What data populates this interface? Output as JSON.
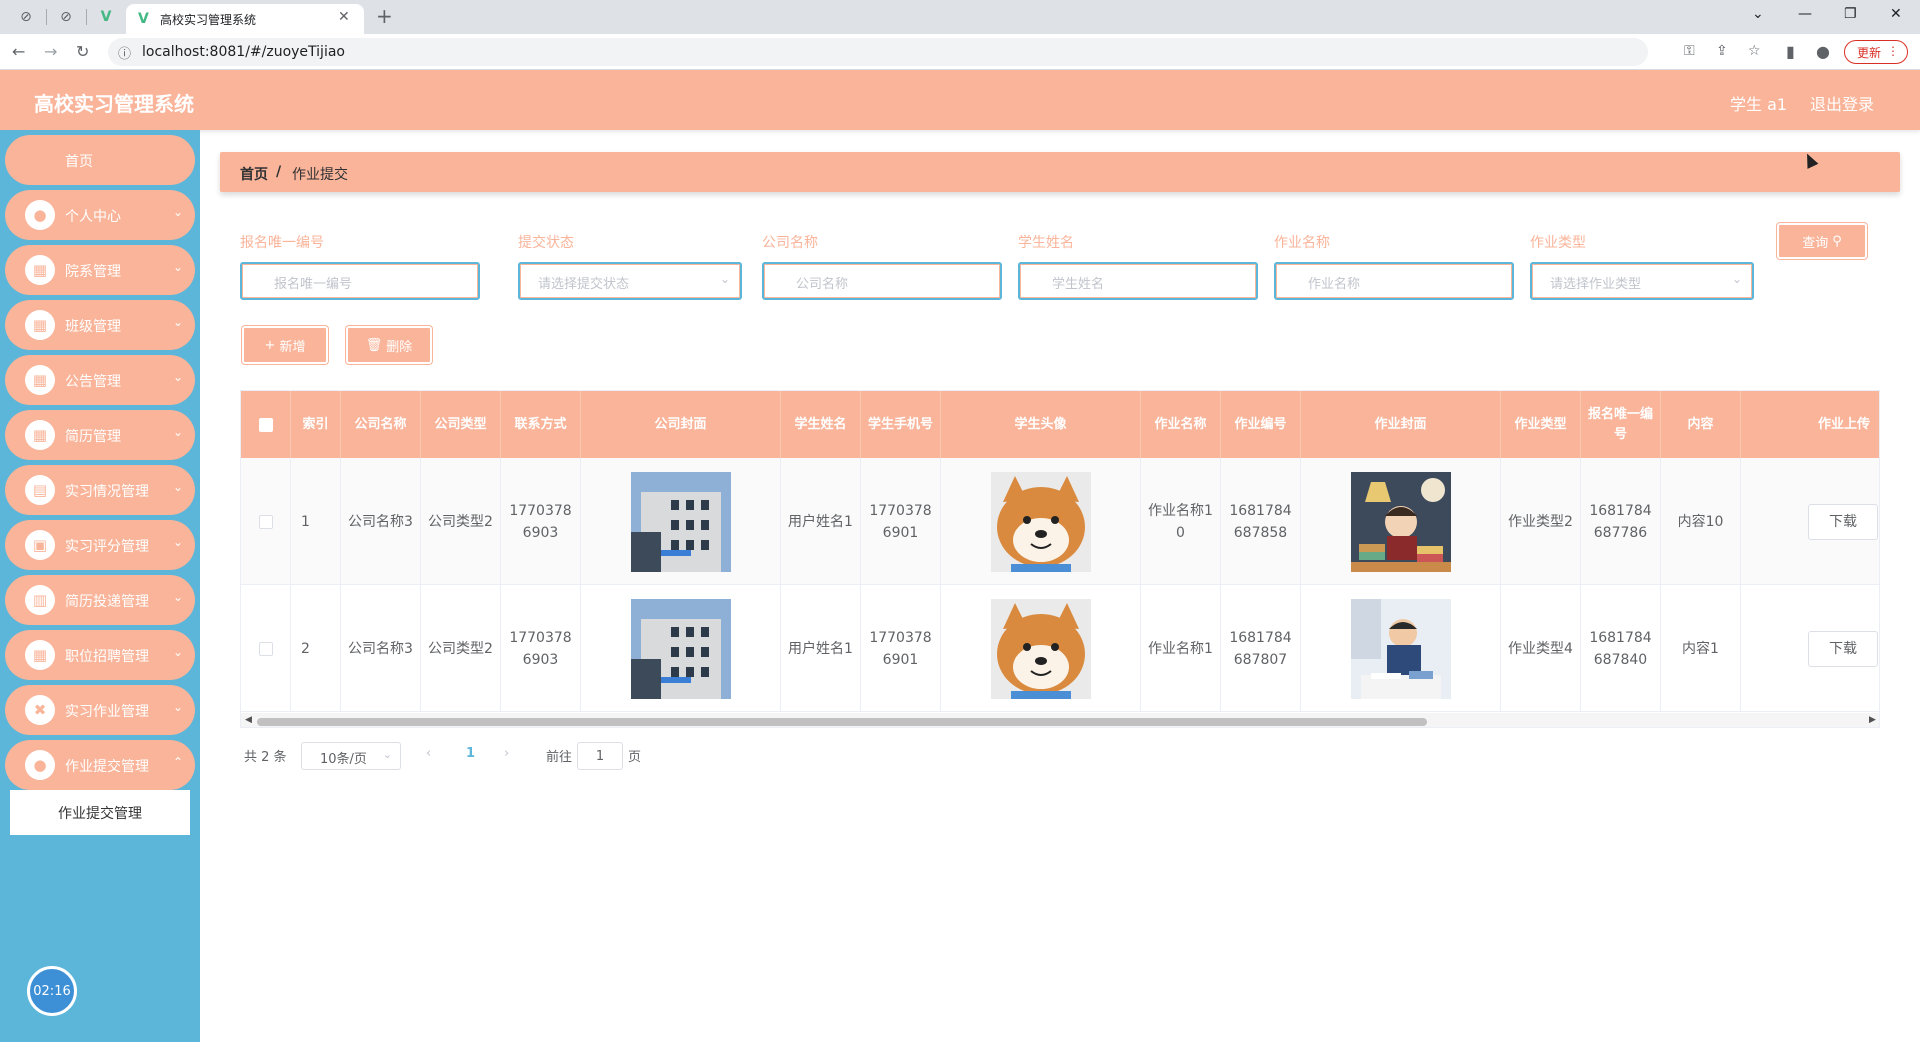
{
  "browser": {
    "tab_title": "高校实习管理系统",
    "url": "localhost:8081/#/zuoyeTijiao",
    "update_label": "更新"
  },
  "header": {
    "title": "高校实习管理系统",
    "user": "学生 a1",
    "logout": "退出登录"
  },
  "sidebar": {
    "items": [
      {
        "label": "首页",
        "icon": "home-icon"
      },
      {
        "label": "个人中心",
        "icon": "user-icon"
      },
      {
        "label": "院系管理",
        "icon": "grid-icon"
      },
      {
        "label": "班级管理",
        "icon": "grid-icon"
      },
      {
        "label": "公告管理",
        "icon": "grid-icon"
      },
      {
        "label": "简历管理",
        "icon": "grid-icon"
      },
      {
        "label": "实习情况管理",
        "icon": "clipboard-icon"
      },
      {
        "label": "实习评分管理",
        "icon": "briefcase-icon"
      },
      {
        "label": "简历投递管理",
        "icon": "chart-icon"
      },
      {
        "label": "职位招聘管理",
        "icon": "grid-icon"
      },
      {
        "label": "实习作业管理",
        "icon": "cross-icon"
      },
      {
        "label": "作业提交管理",
        "icon": "user-icon"
      }
    ],
    "submenu": "作业提交管理",
    "timer": "02:16"
  },
  "breadcrumb": {
    "home": "首页",
    "sep": "/",
    "current": "作业提交"
  },
  "filters": [
    {
      "label": "报名唯一编号",
      "placeholder": "报名唯一编号"
    },
    {
      "label": "提交状态",
      "placeholder": "请选择提交状态"
    },
    {
      "label": "公司名称",
      "placeholder": "公司名称"
    },
    {
      "label": "学生姓名",
      "placeholder": "学生姓名"
    },
    {
      "label": "作业名称",
      "placeholder": "作业名称"
    },
    {
      "label": "作业类型",
      "placeholder": "请选择作业类型"
    }
  ],
  "actions": {
    "search": "查询",
    "add": "新增",
    "delete": "删除"
  },
  "table": {
    "headers": [
      "索引",
      "公司名称",
      "公司类型",
      "联系方式",
      "公司封面",
      "学生姓名",
      "学生手机号",
      "学生头像",
      "作业名称",
      "作业编号",
      "作业封面",
      "作业类型",
      "报名唯一编号",
      "内容",
      "作业上传"
    ],
    "rows": [
      {
        "index": "1",
        "company": "公司名称3",
        "company_type": "公司类型2",
        "phone": "17703786903",
        "student": "用户姓名1",
        "student_phone": "17703786901",
        "task": "作业名称10",
        "task_no": "1681784687858",
        "task_type": "作业类型2",
        "reg_no": "1681784687786",
        "content": "内容10",
        "download": "下载"
      },
      {
        "index": "2",
        "company": "公司名称3",
        "company_type": "公司类型2",
        "phone": "17703786903",
        "student": "用户姓名1",
        "student_phone": "17703786901",
        "task": "作业名称1",
        "task_no": "1681784687807",
        "task_type": "作业类型4",
        "reg_no": "1681784687840",
        "content": "内容1",
        "download": "下载"
      }
    ]
  },
  "pagination": {
    "total": "共 2 条",
    "page_size": "10条/页",
    "current": "1",
    "goto_prefix": "前往",
    "goto_value": "1",
    "goto_suffix": "页"
  },
  "colors": {
    "accent": "#f9b49a",
    "sidebar": "#5bb6d9",
    "input_border": "#5bb6d9"
  }
}
